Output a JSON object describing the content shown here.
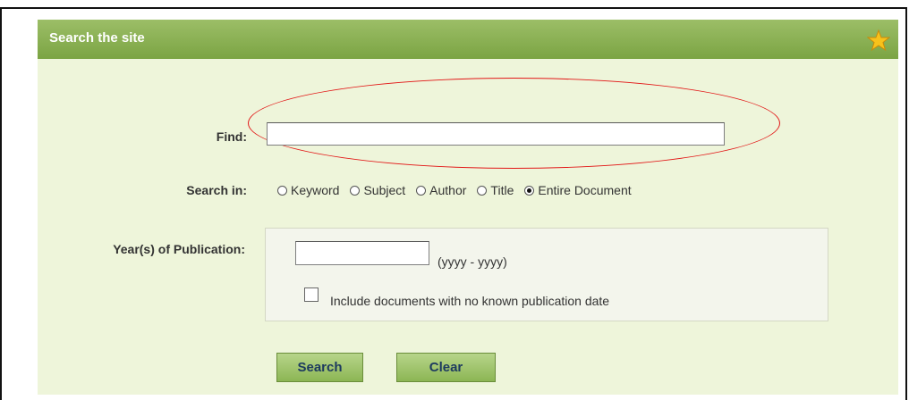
{
  "panel": {
    "title": "Search the site",
    "icon": "star-icon"
  },
  "find": {
    "label": "Find:",
    "value": ""
  },
  "search_in": {
    "label": "Search in:",
    "options": [
      "Keyword",
      "Subject",
      "Author",
      "Title",
      "Entire Document"
    ],
    "selected": "Entire Document"
  },
  "years": {
    "label": "Year(s) of Publication:",
    "value": "",
    "hint": "(yyyy - yyyy)",
    "include_label": "Include documents with no known publication date",
    "include_checked": false
  },
  "buttons": {
    "search": "Search",
    "clear": "Clear"
  },
  "colors": {
    "header": "#87ad52",
    "panel_bg": "#eef5da",
    "highlight_oval": "#e21616"
  }
}
